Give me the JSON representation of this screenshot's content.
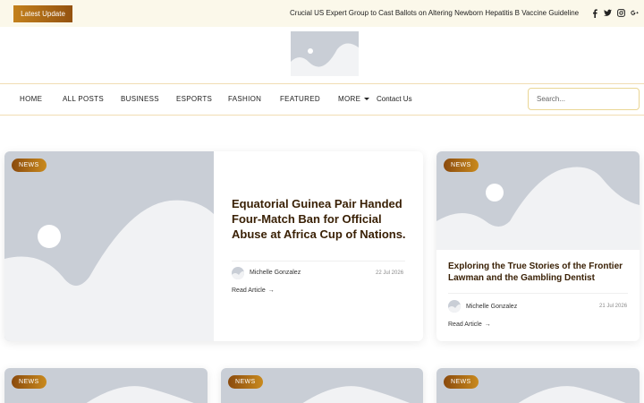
{
  "topbar": {
    "latest_label": "Latest Update",
    "ticker": "Crucial US Expert Group to Cast Ballots on Altering Newborn Hepatitis B Vaccine Guideline",
    "social_icons": [
      "facebook-icon",
      "twitter-icon",
      "instagram-icon",
      "google-plus-icon"
    ]
  },
  "nav": {
    "items": [
      "HOME",
      "ALL POSTS",
      "BUSINESS",
      "ESPORTS",
      "FASHION",
      "FEATURED",
      "MORE",
      "Contact Us"
    ],
    "search_placeholder": "Search..."
  },
  "featured": {
    "badge": "NEWS",
    "title": "Equatorial Guinea Pair Handed Four-Match Ban for Official Abuse at Africa Cup of Nations.",
    "author": "Michelle Gonzalez",
    "date": "22 Jul 2026",
    "read_more": "Read Article"
  },
  "side_card": {
    "badge": "NEWS",
    "title": "Exploring the True Stories of the Frontier Lawman and the Gambling Dentist",
    "author": "Michelle Gonzalez",
    "date": "21 Jul 2026",
    "read_more": "Read Article"
  },
  "bottom_cards": [
    {
      "badge": "NEWS"
    },
    {
      "badge": "NEWS"
    },
    {
      "badge": "NEWS"
    }
  ],
  "colors": {
    "accent": "#b8771a",
    "topbar_bg": "#fbf8ea",
    "placeholder_bg": "#c9ced6",
    "title": "#3a2106"
  }
}
